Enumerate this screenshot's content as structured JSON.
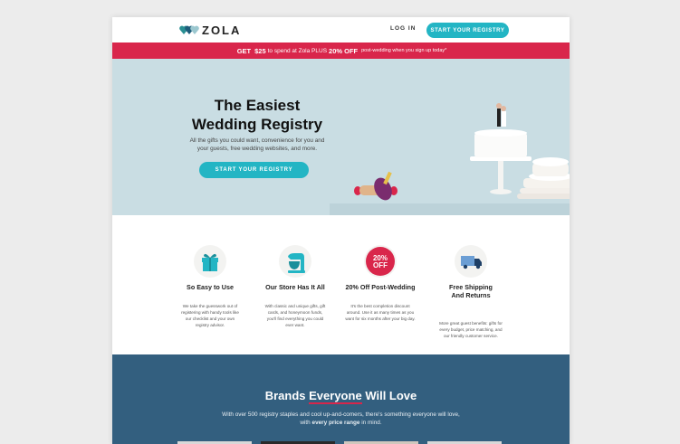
{
  "header": {
    "logo_text": "ZOLA",
    "login_label": "LOG IN",
    "cta_label": "START YOUR REGISTRY"
  },
  "promo": {
    "part1": "GET",
    "amount": "$25",
    "part2": "to spend at Zola PLUS",
    "discount": "20% OFF",
    "part3": "post-wedding when you sign up today*"
  },
  "hero": {
    "title_line1": "The Easiest",
    "title_line2": "Wedding Registry",
    "subtitle_line1": "All the gifts you could want, convenience for you and",
    "subtitle_line2": "your guests, free wedding websites, and more.",
    "cta_label": "START YOUR REGISTRY"
  },
  "features": [
    {
      "icon": "gift-icon",
      "title_line1": "So Easy to Use",
      "title_line2": "",
      "desc_lines": [
        "We take the guesswork out of",
        "registering with handy tools like",
        "our checklist and your own",
        "registry advisor."
      ]
    },
    {
      "icon": "stand-mixer-icon",
      "title_line1": "Our Store Has It All",
      "title_line2": "",
      "desc_lines": [
        "With classic and unique gifts, gift",
        "cards, and honeymoon funds,",
        "you'll find everything you could",
        "ever want."
      ]
    },
    {
      "icon": "discount-badge-icon",
      "badge_text_1": "20%",
      "badge_text_2": "OFF",
      "title_line1": "20% Off Post-Wedding",
      "title_line2": "",
      "desc_lines": [
        "It's the best completion discount",
        "around. Use it as many times as you",
        "want for six months after your big day."
      ]
    },
    {
      "icon": "delivery-truck-icon",
      "title_line1": "Free Shipping",
      "title_line2": "And Returns",
      "desc_lines": [
        "More great guest benefits: gifts for",
        "every budget, price matching, and",
        "our friendly customer service."
      ]
    }
  ],
  "brands": {
    "title_prefix": "Brands",
    "title_underlined": "Everyone",
    "title_suffix": "Will Love",
    "subtitle_line1": "With over 500 registry staples and cool up-and-comers, there's something everyone will love,",
    "subtitle_prefix": "with",
    "subtitle_bold": "every price range",
    "subtitle_suffix": "in mind."
  },
  "colors": {
    "accent": "#23b5c4",
    "promo": "#d9264b",
    "hero_bg": "#c9dde3",
    "brands_bg": "#335f7f"
  }
}
